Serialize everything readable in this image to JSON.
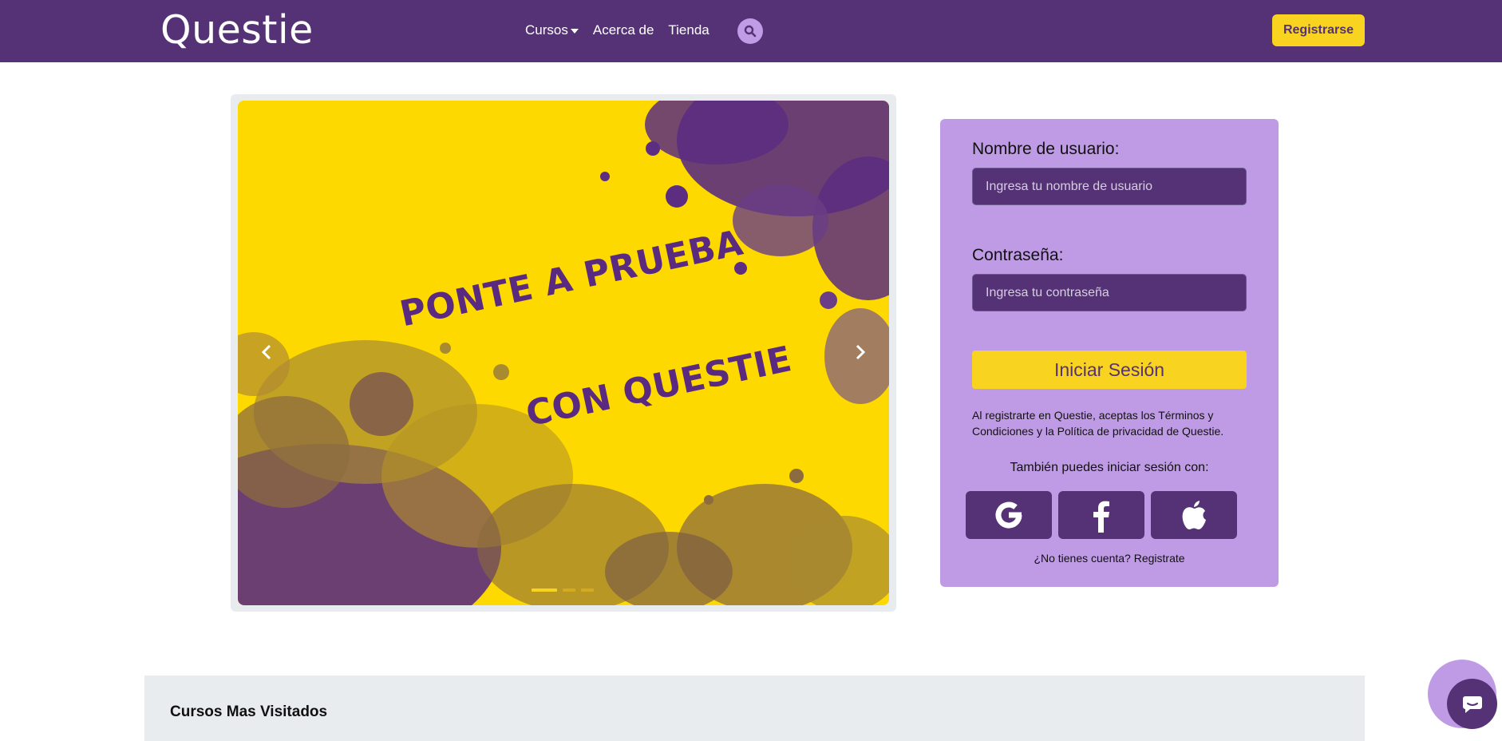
{
  "header": {
    "brand": "Questie",
    "nav": [
      {
        "label": "Cursos"
      },
      {
        "label": "Acerca de"
      },
      {
        "label": "Tienda"
      }
    ],
    "signup_label": "Registrarse"
  },
  "carousel": {
    "line1": "PONTE A PRUEBA",
    "line2": "CON QUESTIE",
    "prev": "‹",
    "next": "›",
    "slides_count": 3,
    "active_slide": 1
  },
  "login": {
    "username_label": "Nombre de usuario:",
    "username_placeholder": "Ingresa tu nombre de usuario",
    "password_label": "Contraseña:",
    "password_placeholder": "Ingresa tu contraseña",
    "submit_label": "Iniciar Sesión",
    "terms": "Al registrarte en Questie, aceptas los Términos y Condiciones y la Política de privacidad de Questie.",
    "also_label": "También puedes iniciar sesión con:",
    "social": [
      {
        "icon": "google-icon"
      },
      {
        "icon": "facebook-icon"
      },
      {
        "icon": "apple-icon"
      }
    ],
    "no_account": "¿No tienes cuenta? Registrate"
  },
  "section": {
    "title": "Cursos Mas Visitados"
  },
  "colors": {
    "primary": "#553275",
    "accent": "#f8d31f",
    "card": "#bf9be6",
    "slide_bg": "#fdd900"
  }
}
